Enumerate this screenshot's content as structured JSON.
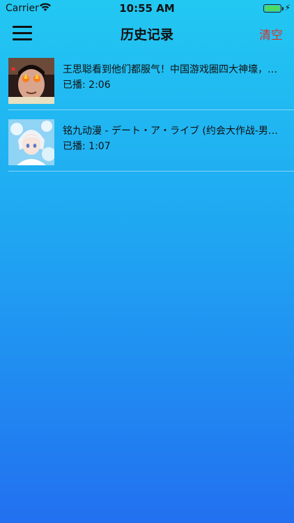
{
  "status": {
    "carrier": "Carrier",
    "time": "10:55 AM",
    "battery_level": 1.0
  },
  "nav": {
    "title": "历史记录",
    "clear_label": "清空",
    "accent_color": "#d9322b"
  },
  "history": [
    {
      "title": "王思聪看到他们都服气！中国游戏圈四大神壕，为…",
      "played_label": "已播:",
      "played_time": "2:06",
      "thumb_icon": "person-photo-thumbnail"
    },
    {
      "title": "铭九动漫 - デート・ア・ライブ (约会大作战-男声…",
      "played_label": "已播:",
      "played_time": "1:07",
      "thumb_icon": "anime-character-thumbnail"
    }
  ]
}
